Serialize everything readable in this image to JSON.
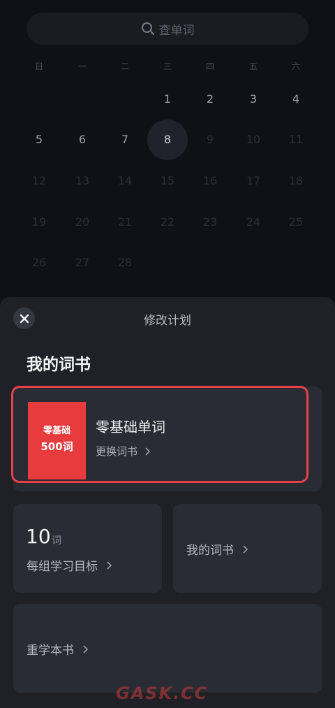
{
  "search": {
    "placeholder": "查单词"
  },
  "calendar": {
    "weekdays": [
      "日",
      "一",
      "二",
      "三",
      "四",
      "五",
      "六"
    ],
    "row1": [
      "1",
      "2",
      "3",
      "4"
    ],
    "row2": [
      "5",
      "6",
      "7",
      "8",
      "9",
      "10",
      "11"
    ],
    "row3": [
      "12",
      "13",
      "14",
      "15",
      "16",
      "17",
      "18"
    ],
    "row4": [
      "19",
      "20",
      "21",
      "22",
      "23",
      "24",
      "25"
    ],
    "row5": [
      "26",
      "27",
      "28"
    ],
    "today": "8"
  },
  "sheet": {
    "title": "修改计划",
    "section_title": "我的词书",
    "book": {
      "cover_line1": "零基础",
      "cover_line2": "500词",
      "name": "零基础单词",
      "change_label": "更换词书"
    },
    "goal": {
      "number": "10",
      "unit": "词",
      "label": "每组学习目标"
    },
    "my_books_label": "我的词书",
    "relearn_label": "重学本书"
  },
  "watermark": "GASK.CC",
  "colors": {
    "accent_red": "#e8414a",
    "sheet_bg": "#1f2127",
    "tile_bg": "#2a2c33"
  },
  "icons": {
    "search": "search-icon",
    "close": "close-icon",
    "chevron": "chevron-right-icon"
  }
}
